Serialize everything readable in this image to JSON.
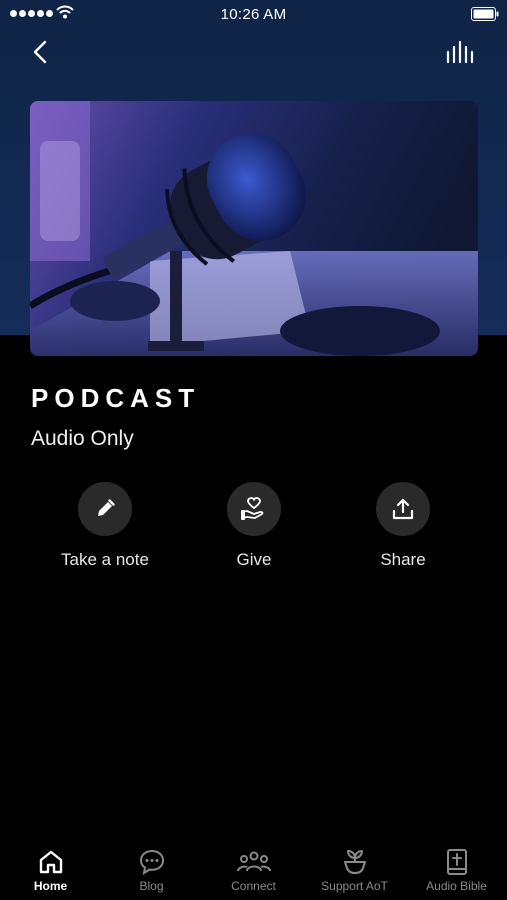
{
  "status_bar": {
    "time": "10:26 AM"
  },
  "header": {
    "back_icon": "chevron-left-icon",
    "stats_icon": "audio-bars-icon"
  },
  "podcast": {
    "title": "PODCAST",
    "subtitle": "Audio Only"
  },
  "actions": [
    {
      "label": "Take a note",
      "icon": "pencil-icon"
    },
    {
      "label": "Give",
      "icon": "heart-hand-icon"
    },
    {
      "label": "Share",
      "icon": "share-icon"
    }
  ],
  "tabs": [
    {
      "label": "Home",
      "icon": "home-icon",
      "active": true
    },
    {
      "label": "Blog",
      "icon": "chat-bubble-icon",
      "active": false
    },
    {
      "label": "Connect",
      "icon": "people-icon",
      "active": false
    },
    {
      "label": "Support AoT",
      "icon": "plant-icon",
      "active": false
    },
    {
      "label": "Audio Bible",
      "icon": "bible-icon",
      "active": false
    }
  ],
  "colors": {
    "header_bg": "#122a52",
    "background": "#000000",
    "action_circle": "#2a2a2a",
    "inactive_tab": "#8a8a8a"
  }
}
